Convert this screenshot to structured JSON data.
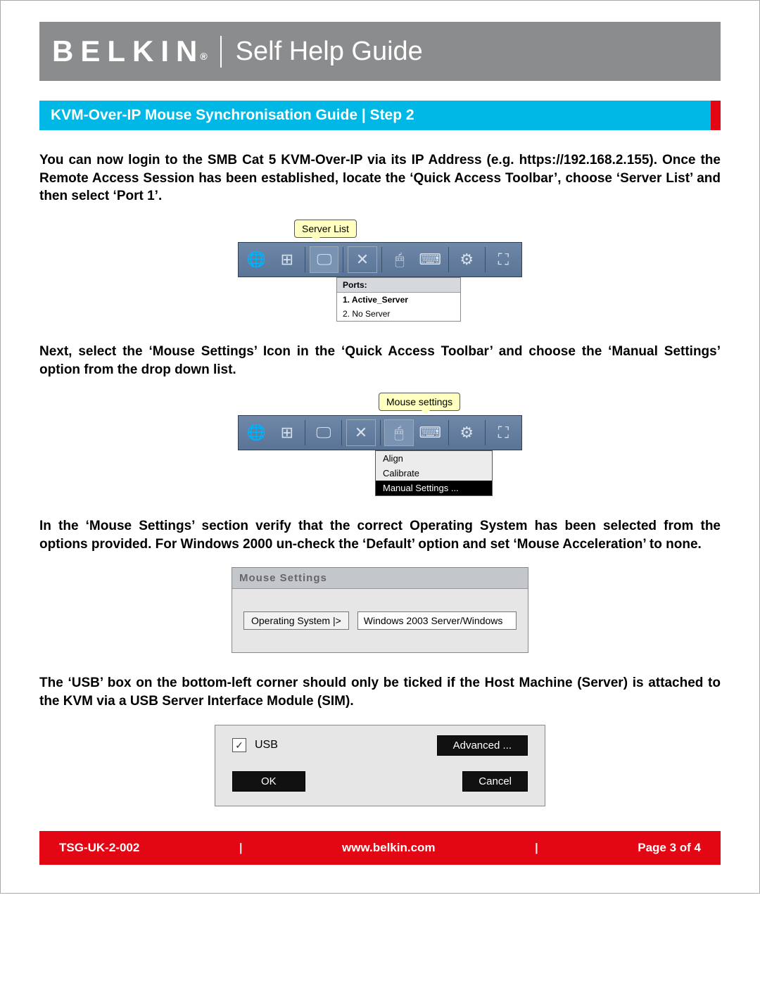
{
  "header": {
    "brand": "BELKIN",
    "brand_suffix": "®",
    "title": "Self Help Guide"
  },
  "sub_banner": "KVM-Over-IP Mouse Synchronisation Guide | Step 2",
  "para1": "You can now login to the SMB Cat 5 KVM-Over-IP via its IP Address (e.g. https://192.168.2.155). Once the Remote Access Session has been established, locate the ‘Quick Access Toolbar’, choose ‘Server List’ and then select ‘Port 1’.",
  "shot1": {
    "callout": "Server List",
    "ports_header": "Ports:",
    "ports": [
      "1. Active_Server",
      "2. No Server"
    ]
  },
  "para2": "Next, select the ‘Mouse Settings’ Icon in the ‘Quick Access Toolbar’ and choose the ‘Manual Settings’ option from the drop down list.",
  "shot2": {
    "callout": "Mouse settings",
    "menu": [
      "Align",
      "Calibrate",
      "Manual Settings ..."
    ]
  },
  "para3": "In the ‘Mouse Settings’ section verify that the correct Operating System has been selected from the options provided. For Windows 2000 un-check the ‘Default’ option and set ‘Mouse Acceleration’ to none.",
  "shot3": {
    "title": "Mouse Settings",
    "os_button": "Operating System |>",
    "os_value": "Windows 2003 Server/Windows"
  },
  "para4": "The ‘USB’ box on the bottom-left corner should only be ticked if the Host Machine (Server) is attached to the KVM via a USB Server Interface Module (SIM).",
  "shot4": {
    "usb_label": "USB",
    "advanced": "Advanced ...",
    "ok": "OK",
    "cancel": "Cancel"
  },
  "footer": {
    "doc_id": "TSG-UK-2-002",
    "url": "www.belkin.com",
    "page": "Page 3 of 4",
    "sep": "|"
  },
  "icons": {
    "globe": "🌐",
    "net": "⊞",
    "monitor": "🖵",
    "close": "✕",
    "mouse": "🖱",
    "keyboard": "⌨",
    "gear": "⚙",
    "max": "⛶",
    "check": "✓"
  }
}
